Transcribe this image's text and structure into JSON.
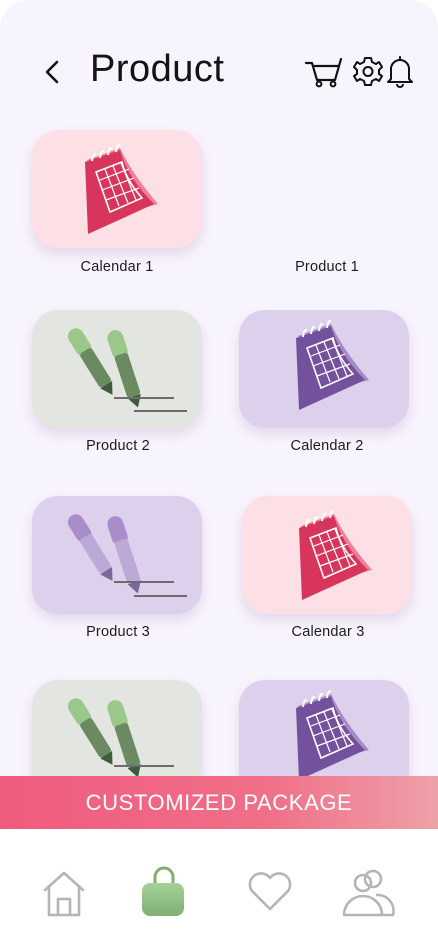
{
  "header": {
    "title": "Product",
    "icons": [
      "back-arrow-icon",
      "cart-icon",
      "gear-icon",
      "bell-icon"
    ]
  },
  "products": [
    {
      "label": "Calendar 1",
      "type": "calendar",
      "theme": "pink"
    },
    {
      "label": "Product 1",
      "type": "empty",
      "theme": "none"
    },
    {
      "label": "Product 2",
      "type": "pens",
      "theme": "gray"
    },
    {
      "label": "Calendar 2",
      "type": "calendar",
      "theme": "lavender"
    },
    {
      "label": "Product 3",
      "type": "pens",
      "theme": "lavender"
    },
    {
      "label": "Calendar 3",
      "type": "calendar",
      "theme": "pink"
    },
    {
      "label": "",
      "type": "pens",
      "theme": "gray"
    },
    {
      "label": "",
      "type": "calendar",
      "theme": "lavender"
    }
  ],
  "cta": {
    "label": "CUSTOMIZED PACKAGE"
  },
  "bottom_nav": {
    "items": [
      "home-icon",
      "shopping-bag-icon",
      "heart-icon",
      "users-icon"
    ],
    "active": "shopping-bag-icon"
  },
  "colors": {
    "background": "#f8f4fd",
    "cta_start": "#ef5b7e",
    "cta_end": "#eea1a8",
    "active_bag": "#8fbf83",
    "pink_card": "#fde0e5",
    "gray_card": "#e3e6e0",
    "lavender_card": "#ddd0ec"
  }
}
